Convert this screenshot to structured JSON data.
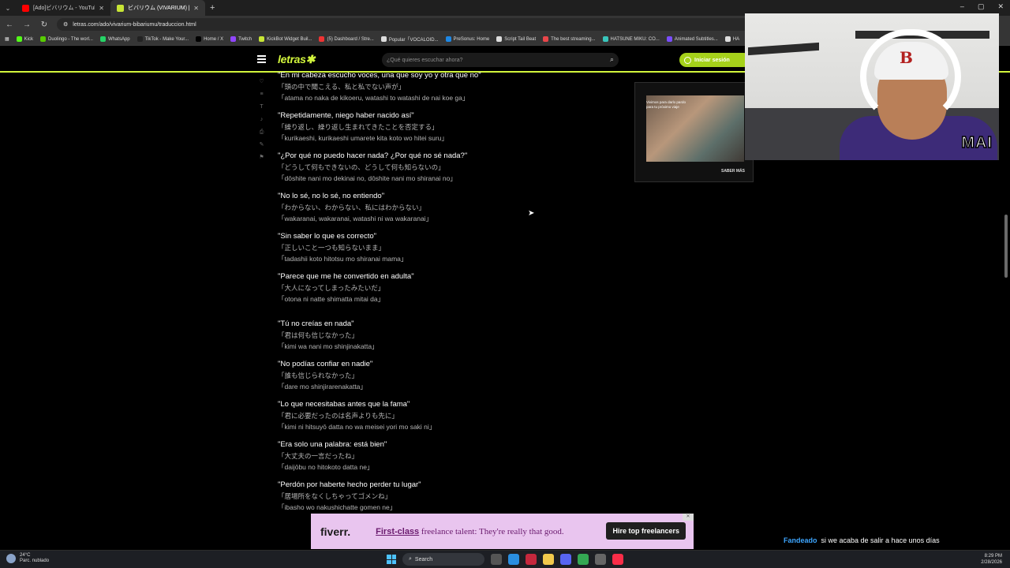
{
  "browser": {
    "tabs": [
      {
        "title": "[Ado]ビバリウム - YouTube",
        "color": "#ff0000",
        "active": false
      },
      {
        "title": "ビバリウム (VIVARIUM) [EN ESPAÑ",
        "color": "#c7e535",
        "active": true
      }
    ],
    "url": "letras.com/ado/vivarium-bibariumu/traduccion.html",
    "bookmarks": [
      "Kick",
      "Duolingo - The worl...",
      "WhatsApp",
      "TikTok - Make Your...",
      "Home / X",
      "Twitch",
      "KickBot Widget Buil...",
      "(5) Dashboard / Stre...",
      "Popular「VOCALOID...",
      "PreSonus: Home",
      "Script Tail Beat",
      "The best streaming...",
      "HATSUNE MIKU: CO...",
      "Animated Subtitles...",
      "HA"
    ]
  },
  "site": {
    "logo": "letras",
    "search_placeholder": "¿Qué quieres escuchar ahora?",
    "login_label": "Iniciar sesión",
    "accent": "#d2f53c"
  },
  "lyrics": [
    {
      "es": "\"En mi cabeza escucho voces, una que soy yo y otra que no\"",
      "jp": "「頭の中で聞こえる、私と私でない声が」",
      "ro": "「atama no naka de kikoeru, watashi to watashi de nai koe ga」"
    },
    {
      "es": "\"Repetidamente, niego haber nacido así\"",
      "jp": "「繰り返し、繰り返し生まれてきたことを否定する」",
      "ro": "「kurikaeshi, kurikaeshi umarete kita koto wo hitei suru」"
    },
    {
      "es": "\"¿Por qué no puedo hacer nada? ¿Por qué no sé nada?\"",
      "jp": "「どうして何もできないの、どうして何も知らないの」",
      "ro": "「dōshite nani mo dekinai no, dōshite nani mo shiranai no」"
    },
    {
      "es": "\"No lo sé, no lo sé, no entiendo\"",
      "jp": "「わからない、わからない、私にはわからない」",
      "ro": "「wakaranai, wakaranai, watashi ni wa wakaranai」"
    },
    {
      "es": "\"Sin saber lo que es correcto\"",
      "jp": "「正しいこと一つも知らないまま」",
      "ro": "「tadashii koto hitotsu mo shiranai mama」"
    },
    {
      "es": "\"Parece que me he convertido en adulta\"",
      "jp": "「大人になってしまったみたいだ」",
      "ro": "「otona ni natte shimatta mitai da」"
    },
    {
      "es": "\"Tú no creías en nada\"",
      "jp": "「君は何も信じなかった」",
      "ro": "「kimi wa nani mo shinjinakatta」"
    },
    {
      "es": "\"No podías confiar en nadie\"",
      "jp": "「誰も信じられなかった」",
      "ro": "「dare mo shinjirarenakatta」"
    },
    {
      "es": "\"Lo que necesitabas antes que la fama\"",
      "jp": "「君に必要だったのは名声よりも先に」",
      "ro": "「kimi ni hitsuyō datta no wa meisei yori mo saki ni」"
    },
    {
      "es": "\"Era solo una palabra: está bien\"",
      "jp": "「大丈夫の一言だったね」",
      "ro": "「daijōbu no hitokoto datta ne」"
    },
    {
      "es": "\"Perdón por haberte hecho perder tu lugar\"",
      "jp": "「居場所をなくしちゃってゴメンね」",
      "ro": "「ibasho wo nakushichatte gomen ne」"
    }
  ],
  "side_ad": {
    "text": "Vivimos para darlo pardo para tu próximo viaje",
    "more": "SABER MÁS"
  },
  "webcam": {
    "overlay_name": "MAI"
  },
  "fiverr_ad": {
    "logo": "fiverr.",
    "tag_bold": "First-class",
    "tag_rest": " freelance talent: They're really that good.",
    "cta": "Hire top freelancers"
  },
  "chat": {
    "user": "Fandeado",
    "message": "si we acaba de salir a hace unos días"
  },
  "taskbar": {
    "temp": "24°C",
    "weather": "Parc. nublado",
    "search": "Search",
    "time": "8:29 PM",
    "date": "2/28/2026"
  }
}
